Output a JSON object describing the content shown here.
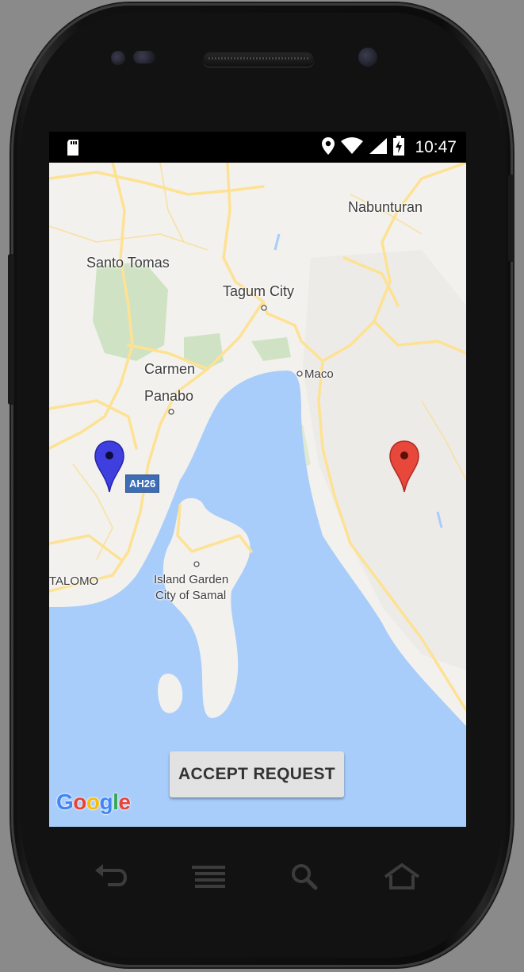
{
  "status_bar": {
    "time": "10:47",
    "icons": [
      "sd-card-icon",
      "location-icon",
      "wifi-icon",
      "cell-signal-icon",
      "battery-charging-icon"
    ]
  },
  "map": {
    "labels": {
      "nabunturan": "Nabunturan",
      "santo_tomas": "Santo Tomas",
      "tagum_city": "Tagum City",
      "carmen": "Carmen",
      "panabo": "Panabo",
      "maco": "Maco",
      "talomo": "TALOMO",
      "samal_line1": "Island Garden",
      "samal_line2": "City of Samal"
    },
    "road_shield": "AH26",
    "markers": [
      {
        "name": "blue-marker",
        "color": "#3f3fe0"
      },
      {
        "name": "red-marker",
        "color": "#e8483b"
      }
    ],
    "attribution": {
      "letters": [
        "G",
        "o",
        "o",
        "g",
        "l",
        "e"
      ],
      "colors": [
        "#4285f4",
        "#ea4335",
        "#fbbc05",
        "#4285f4",
        "#34a853",
        "#ea4335"
      ]
    }
  },
  "accept_button": {
    "label": "ACCEPT REQUEST"
  },
  "nav_bar": {
    "icons": [
      "back-icon",
      "menu-icon",
      "search-icon",
      "home-icon"
    ]
  },
  "colors": {
    "water": "#a8cdfb",
    "land": "#f3f1ed",
    "road": "#fde293",
    "park": "#cfe3c4"
  }
}
